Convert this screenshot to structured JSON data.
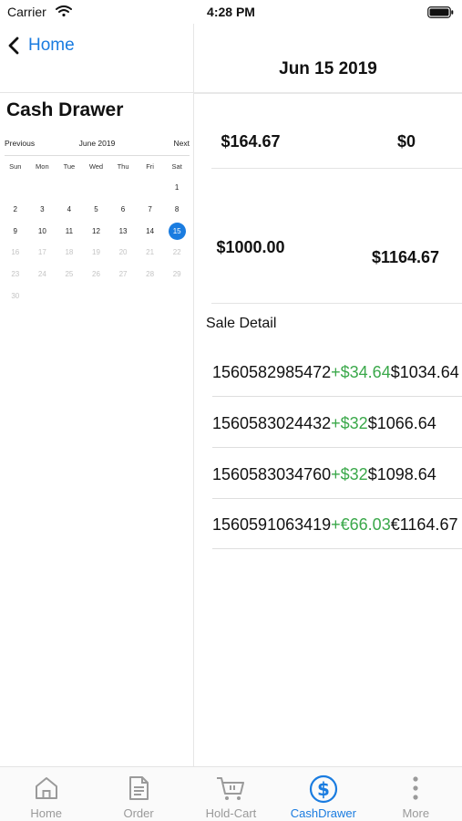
{
  "status_bar": {
    "carrier": "Carrier",
    "time": "4:28 PM"
  },
  "nav": {
    "back_label": "Home",
    "date_title": "Jun 15 2019"
  },
  "page_title": "Cash Drawer",
  "calendar": {
    "prev_label": "Previous",
    "month_label": "June 2019",
    "next_label": "Next",
    "weekdays": [
      "Sun",
      "Mon",
      "Tue",
      "Wed",
      "Thu",
      "Fri",
      "Sat"
    ],
    "leading_blanks": 6,
    "days": [
      "1",
      "2",
      "3",
      "4",
      "5",
      "6",
      "7",
      "8",
      "9",
      "10",
      "11",
      "12",
      "13",
      "14",
      "15",
      "16",
      "17",
      "18",
      "19",
      "20",
      "21",
      "22",
      "23",
      "24",
      "25",
      "26",
      "27",
      "28",
      "29",
      "30"
    ],
    "selected_day": "15",
    "last_enabled_day": 15
  },
  "summary": {
    "val1": "$164.67",
    "val2": "$0",
    "val3": "$1000.00",
    "val4": "$1164.67"
  },
  "sale_detail_label": "Sale Detail",
  "sales": [
    {
      "id": "1560582985472",
      "amount": "+$34.64",
      "total": "$1034.64"
    },
    {
      "id": "1560583024432",
      "amount": "+$32",
      "total": "$1066.64"
    },
    {
      "id": "1560583034760",
      "amount": "+$32",
      "total": "$1098.64"
    },
    {
      "id": "1560591063419",
      "amount": "+€66.03",
      "total": "€1164.67"
    }
  ],
  "tabs": [
    {
      "label": "Home",
      "icon": "home-icon"
    },
    {
      "label": "Order",
      "icon": "document-icon"
    },
    {
      "label": "Hold-Cart",
      "icon": "cart-icon"
    },
    {
      "label": "CashDrawer",
      "icon": "dollar-circle-icon"
    },
    {
      "label": "More",
      "icon": "more-vertical-icon"
    }
  ],
  "active_tab": "CashDrawer",
  "colors": {
    "accent": "#1a7ce0",
    "positive": "#3aa84a",
    "inactive": "#9a9a9a"
  }
}
